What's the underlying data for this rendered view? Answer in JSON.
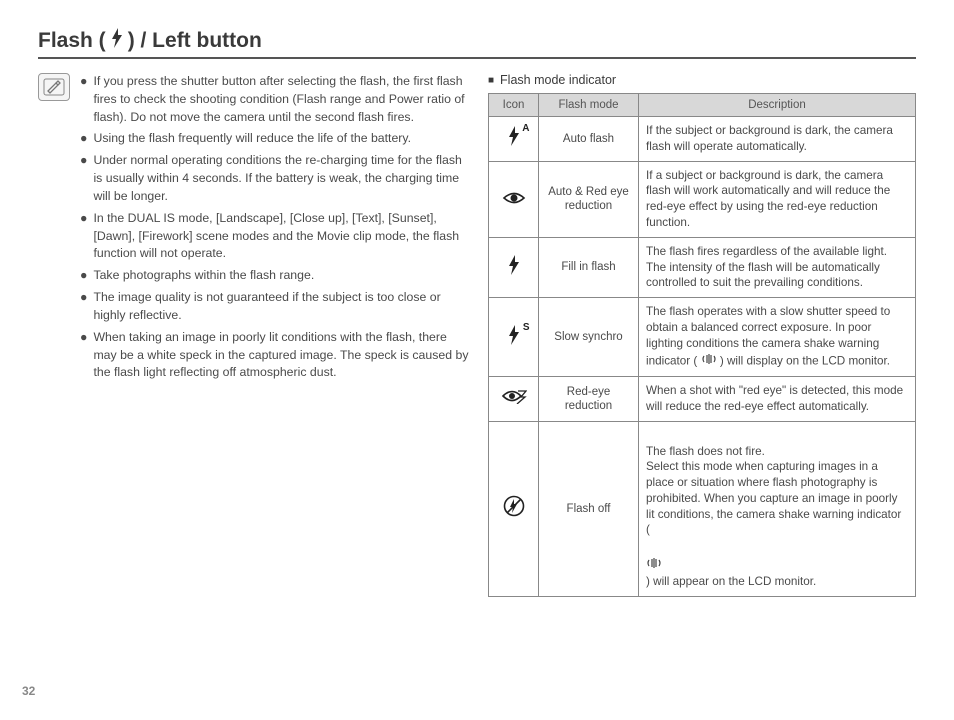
{
  "title": {
    "prefix": "Flash (",
    "suffix": ") / Left button"
  },
  "notes": {
    "bullets": [
      "If you press the shutter button after selecting the flash, the first flash fires to check the shooting condition (Flash range and Power ratio of flash). Do not move the camera until the second flash fires.",
      "Using the flash frequently will reduce the life of the battery.",
      "Under normal operating conditions the re-charging time for the flash is usually within 4 seconds. If the battery is weak, the charging time will be longer.",
      "In the DUAL IS mode, [Landscape], [Close up], [Text], [Sunset], [Dawn], [Firework] scene modes and the Movie clip mode, the flash function will not operate.",
      "Take photographs within the flash range.",
      "The image quality is not guaranteed if the subject is too close or highly reflective.",
      "When taking an image in poorly lit conditions with the flash, there may be a white speck in the captured image. The speck is caused by the flash light reflecting off atmospheric dust."
    ]
  },
  "table": {
    "caption": "Flash mode indicator",
    "headers": {
      "icon": "Icon",
      "mode": "Flash mode",
      "desc": "Description"
    },
    "rows": [
      {
        "icon_name": "flash-auto-icon",
        "mode": "Auto flash",
        "desc": "If the subject or background is dark, the camera flash will operate automatically."
      },
      {
        "icon_name": "eye-icon",
        "mode": "Auto & Red eye reduction",
        "desc": "If a subject or background is dark, the camera flash will work automatically and will reduce the red-eye effect by using the red-eye reduction function."
      },
      {
        "icon_name": "flash-icon",
        "mode": "Fill in flash",
        "desc": "The flash fires regardless of the available light. The intensity of the flash will be automatically controlled to suit the prevailing conditions."
      },
      {
        "icon_name": "flash-slow-icon",
        "mode": "Slow synchro",
        "desc_pre": "The flash operates with a slow shutter speed to obtain a balanced correct exposure. In poor lighting conditions the camera shake warning indicator (",
        "desc_post": ") will display on the LCD monitor."
      },
      {
        "icon_name": "redeye-reduction-icon",
        "mode": "Red-eye reduction",
        "desc": "When a shot with \"red eye\" is detected, this mode will reduce the red-eye effect automatically."
      },
      {
        "icon_name": "flash-off-icon",
        "mode": "Flash off",
        "desc_pre": "The flash does not fire.\nSelect this mode when capturing images in a place or situation where flash photography is prohibited. When you capture an image in poorly lit conditions, the camera shake warning indicator (",
        "desc_post": ") will appear on the LCD monitor."
      }
    ]
  },
  "page_number": "32"
}
